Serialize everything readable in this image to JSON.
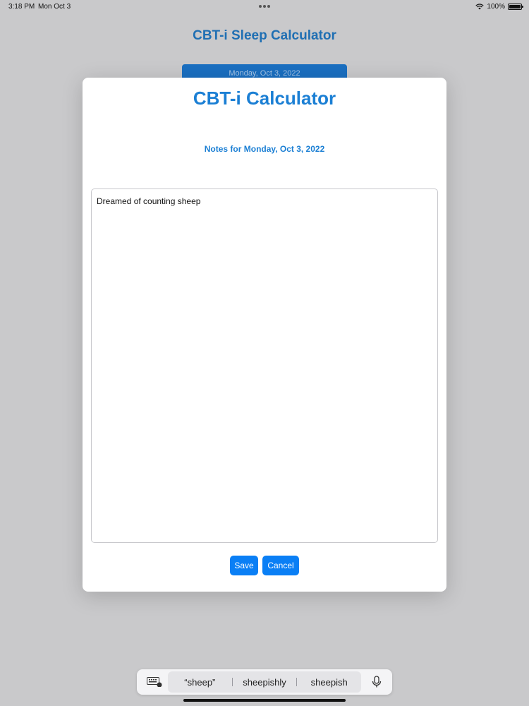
{
  "status_bar": {
    "time": "3:18 PM",
    "date": "Mon Oct 3",
    "battery_label": "100%",
    "icons": [
      "wifi-icon",
      "battery-icon"
    ]
  },
  "background": {
    "title": "CBT-i Sleep Calculator",
    "date_button": "Monday, Oct 3, 2022"
  },
  "modal": {
    "title": "CBT-i Calculator",
    "notes_heading": "Notes for Monday, Oct 3, 2022",
    "notes_value": "Dreamed of counting sheep",
    "save_label": "Save",
    "cancel_label": "Cancel"
  },
  "keyboard": {
    "suggestions": [
      "“sheep”",
      "sheepishly",
      "sheepish"
    ],
    "icons": [
      "keyboard-icon",
      "microphone-icon"
    ]
  },
  "colors": {
    "accent": "#1b7fd4",
    "button": "#0a7ff5",
    "overlay_background": "#c9c9cb"
  }
}
